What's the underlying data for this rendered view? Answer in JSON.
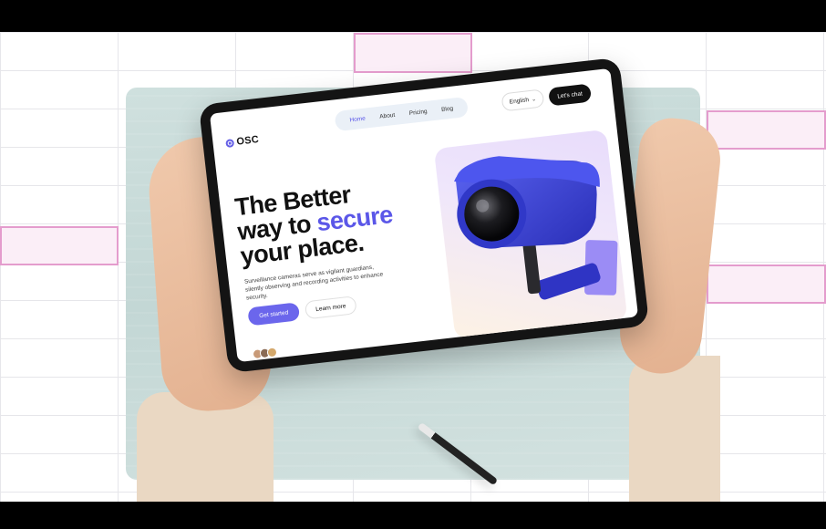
{
  "site": {
    "logo_text": "OSC",
    "nav": [
      {
        "label": "Home",
        "active": true
      },
      {
        "label": "About",
        "active": false
      },
      {
        "label": "Pricing",
        "active": false
      },
      {
        "label": "Blog",
        "active": false
      }
    ],
    "language": "English",
    "cta": "Let's chat",
    "headline": {
      "line1": "The Better",
      "line2_prefix": "way to ",
      "line2_accent": "secure",
      "line3": "your place."
    },
    "description": "Surveillance cameras serve as vigilant guardians, silently observing and recording activities to enhance security.",
    "primary_button": "Get started",
    "secondary_button": "Learn more"
  },
  "colors": {
    "accent": "#5b57e8",
    "button_primary": "#6b66ec",
    "pink_highlight": "#e49ccd",
    "camera_blue": "#3a3fd8"
  },
  "icons": [
    "osc-logo-icon",
    "chevron-down-icon",
    "security-camera-illustration"
  ]
}
